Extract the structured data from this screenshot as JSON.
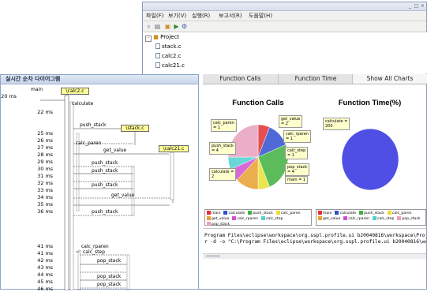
{
  "back_window": {
    "menu": [
      "파일(F)",
      "보기(V)",
      "실행(R)",
      "보고서(R)",
      "도움말(H)"
    ],
    "tree": {
      "root": "Project",
      "files": [
        "stack.c",
        "calc2.c",
        "calc21.c"
      ]
    },
    "tabs": [
      "Function Calls",
      "Function Time",
      "Show All Charts"
    ],
    "active_tab": 2,
    "charts": [
      {
        "chart_data": {
          "type": "pie",
          "title": "Function Calls",
          "slices": [
            {
              "label": "main",
              "value": 1,
              "color": "#e03030"
            },
            {
              "label": "calculate",
              "value": 2,
              "color": "#3050d0"
            },
            {
              "label": "push_stack",
              "value": 4,
              "color": "#40b040"
            },
            {
              "label": "calc_paren",
              "value": 1,
              "color": "#e8e030"
            },
            {
              "label": "get_value",
              "value": 2,
              "color": "#e8a030"
            },
            {
              "label": "calc_rparen",
              "value": 1,
              "color": "#d050d0"
            },
            {
              "label": "calc_step",
              "value": 1,
              "color": "#50d0d0"
            },
            {
              "label": "pop_stack",
              "value": 4,
              "color": "#e8a0c0"
            }
          ]
        },
        "callouts": [
          "calc_paren\n= 1",
          "get_value\n= 2",
          "calc_rparen\n= 1",
          "push_stack\n= 4",
          "calc_step\n= 1",
          "calculate =\n2",
          "pop_stack\n= 4",
          "main = 1"
        ]
      },
      {
        "chart_data": {
          "type": "pie",
          "title": "Function Time(%)",
          "slices": [
            {
              "label": "calculate",
              "value": 100,
              "color": "#3030e0"
            }
          ]
        },
        "callouts": [
          "calculate =\n200"
        ]
      }
    ],
    "legend": [
      {
        "label": "main",
        "color": "#e03030"
      },
      {
        "label": "calculate",
        "color": "#3050d0"
      },
      {
        "label": "push_stack",
        "color": "#40b040"
      },
      {
        "label": "calc_paren",
        "color": "#e8e030"
      },
      {
        "label": "get_value",
        "color": "#e8a030"
      },
      {
        "label": "calc_rparen",
        "color": "#d050d0"
      },
      {
        "label": "calc_step",
        "color": "#50d0d0"
      },
      {
        "label": "pop_stack",
        "color": "#e8a0c0"
      }
    ],
    "console": [
      "Program Files\\eclipse\\workspace\\org.sspl.profile.ui b20040816\\workspace\\Project.idt",
      "r -d -o \"C:\\Program Files\\eclipse\\workspace\\org.sspl.profile.ui b20040816\\workspace\\Project.id"
    ]
  },
  "front_window": {
    "title": "실시간 순차 다이어그램",
    "first_time": "20 ms",
    "lifelines": [
      "main",
      "\\calc2.c",
      "\\stack.c",
      "\\calc21.c"
    ],
    "times": [
      "22 ms",
      "25 ms",
      "26 ms",
      "27 ms",
      "28 ms",
      "29 ms",
      "30 ms",
      "31 ms",
      "32 ms",
      "33 ms",
      "34 ms",
      "35 ms",
      "36 ms",
      "41 ms",
      "41 ms",
      "42 ms",
      "43 ms",
      "44 ms",
      "45 ms",
      "46 ms"
    ],
    "messages": [
      "calculate",
      "push_stack",
      "calc_paren",
      "get_value",
      "push_stack",
      "push_stack",
      "push_stack",
      "get_value",
      "push_stack",
      "calc_rparen",
      "calc_step",
      "pop_stack",
      "pop_stack",
      "pop_stack"
    ]
  }
}
